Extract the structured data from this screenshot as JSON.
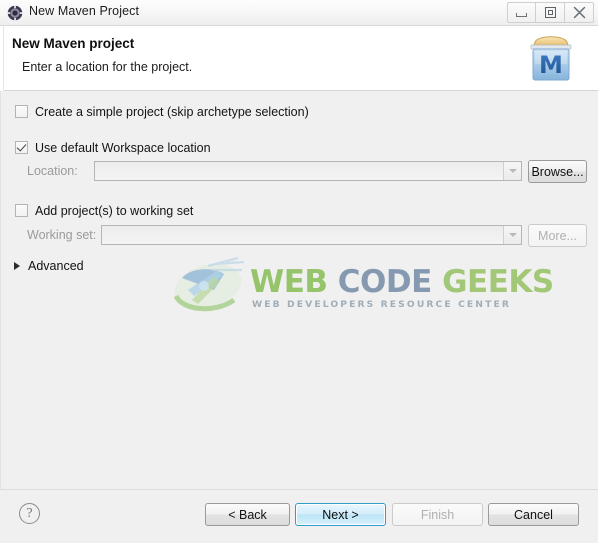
{
  "window": {
    "title": "New Maven Project",
    "icon": "maven-app-icon",
    "controls": [
      {
        "name": "minimize-button",
        "icon": "minimize-icon"
      },
      {
        "name": "maximize-button",
        "icon": "restore-icon"
      },
      {
        "name": "close-button",
        "icon": "close-icon"
      }
    ]
  },
  "header": {
    "title": "New Maven project",
    "subtitle": "Enter a location for the project.",
    "logo_letter": "M",
    "logo_name": "maven-banner-icon"
  },
  "form": {
    "simple_project": {
      "label": "Create a simple project (skip archetype selection)",
      "checked": false
    },
    "default_workspace": {
      "label": "Use default Workspace location",
      "checked": true
    },
    "location": {
      "label": "Location:",
      "value": "",
      "disabled": true,
      "browse_label": "Browse..."
    },
    "working_set_checkbox": {
      "label": "Add project(s) to working set",
      "checked": false
    },
    "working_set": {
      "label": "Working set:",
      "value": "",
      "disabled": true,
      "more_label": "More..."
    },
    "advanced": {
      "label": "Advanced",
      "expanded": false
    }
  },
  "watermark": {
    "word1": "WEB",
    "word2": "CODE",
    "word3": "GEEKS",
    "subtitle": "WEB DEVELOPERS RESOURCE CENTER",
    "color1": "#8ec15f",
    "color2": "#7d93ab",
    "color3": "#9cc46d"
  },
  "footer": {
    "help_label": "?",
    "back_label": "< Back",
    "next_label": "Next >",
    "finish_label": "Finish",
    "cancel_label": "Cancel"
  }
}
